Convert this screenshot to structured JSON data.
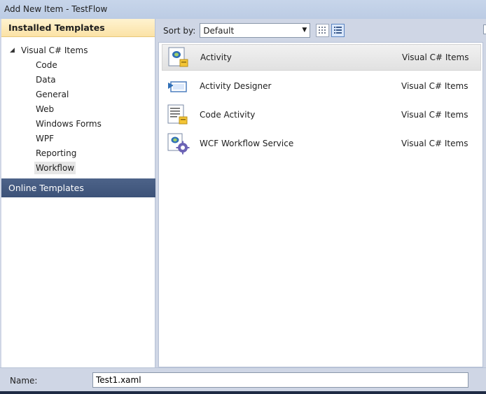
{
  "window": {
    "title": "Add New Item - TestFlow"
  },
  "sidebar": {
    "installed_header": "Installed Templates",
    "root": {
      "label": "Visual C# Items",
      "expander_icon": "triangle-expanded"
    },
    "children": [
      {
        "label": "Code"
      },
      {
        "label": "Data"
      },
      {
        "label": "General"
      },
      {
        "label": "Web"
      },
      {
        "label": "Windows Forms"
      },
      {
        "label": "WPF"
      },
      {
        "label": "Reporting"
      },
      {
        "label": "Workflow",
        "selected": true
      }
    ],
    "online_header": "Online Templates"
  },
  "toolbar": {
    "sort_label": "Sort by:",
    "sort_value": "Default",
    "view_buttons": [
      "small-icons-view-icon",
      "list-view-icon"
    ]
  },
  "templates": [
    {
      "name": "Activity",
      "category": "Visual C# Items",
      "icon": "activity-icon",
      "selected": true
    },
    {
      "name": "Activity Designer",
      "category": "Visual C# Items",
      "icon": "activity-designer-icon"
    },
    {
      "name": "Code Activity",
      "category": "Visual C# Items",
      "icon": "code-activity-icon"
    },
    {
      "name": "WCF Workflow Service",
      "category": "Visual C# Items",
      "icon": "wcf-workflow-service-icon"
    }
  ],
  "name_field": {
    "label": "Name:",
    "value": "Test1.xaml"
  },
  "colors": {
    "installed_header": "#fbe2a6",
    "online_header": "#3c5278",
    "selection": "#e1e1e1"
  }
}
